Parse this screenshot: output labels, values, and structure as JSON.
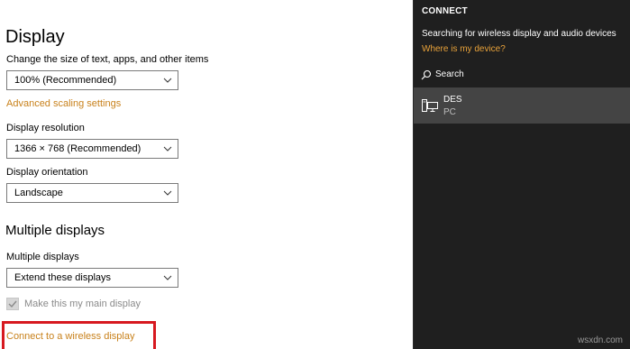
{
  "display": {
    "title": "Display",
    "scale_label": "Change the size of text, apps, and other items",
    "scale_value": "100% (Recommended)",
    "advanced_link": "Advanced scaling settings",
    "resolution_label": "Display resolution",
    "resolution_value": "1366 × 768 (Recommended)",
    "orientation_label": "Display orientation",
    "orientation_value": "Landscape"
  },
  "multiple": {
    "title": "Multiple displays",
    "label": "Multiple displays",
    "value": "Extend these displays",
    "main_checkbox_label": "Make this my main display",
    "main_checkbox_checked": true,
    "wireless_link": "Connect to a wireless display"
  },
  "connect": {
    "title": "CONNECT",
    "searching_text": "Searching for wireless display and audio devices",
    "where_link": "Where is my device?",
    "search_label": "Search",
    "devices": [
      {
        "name": "DES",
        "type": "PC",
        "icon": "display-device-icon"
      }
    ]
  },
  "watermark": "wsxdn.com",
  "colors": {
    "link": "#c8811b",
    "connect_link": "#e8a23a",
    "panel_bg": "#1f1f1f",
    "device_bg": "#444444",
    "highlight": "#d71920"
  }
}
